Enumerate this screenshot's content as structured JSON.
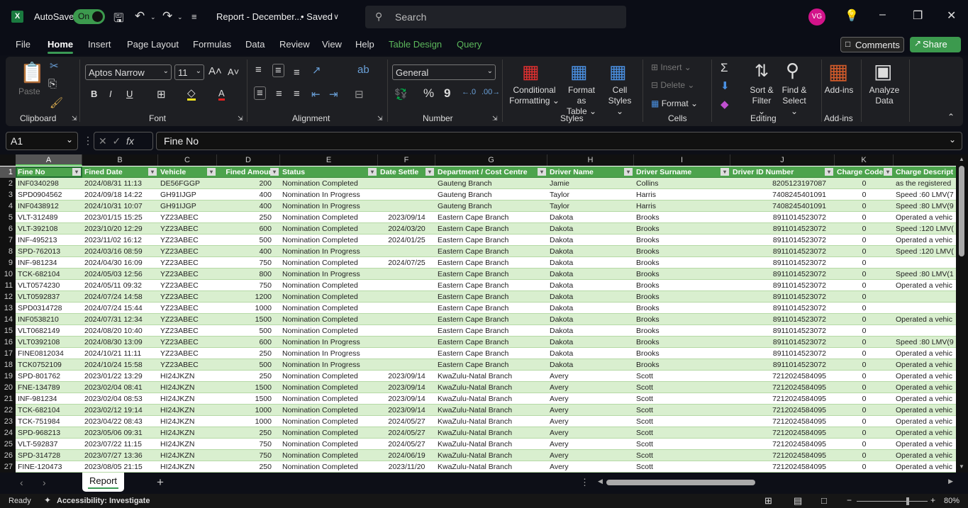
{
  "titlebar": {
    "app_icon": "excel-logo-icon",
    "autosave_label": "AutoSave",
    "autosave_state": "On",
    "doc_title": "Report - December...",
    "doc_status": "• Saved",
    "search_placeholder": "Search",
    "avatar_initials": "VG"
  },
  "menu": {
    "items": [
      "File",
      "Home",
      "Insert",
      "Page Layout",
      "Formulas",
      "Data",
      "Review",
      "View",
      "Help",
      "Table Design",
      "Query"
    ],
    "active": "Home",
    "comments_label": "Comments",
    "share_label": "Share"
  },
  "ribbon": {
    "clipboard": {
      "label": "Clipboard",
      "paste": "Paste"
    },
    "font": {
      "label": "Font",
      "family": "Aptos Narrow",
      "size": "11",
      "bold": "B",
      "italic": "I",
      "underline": "U"
    },
    "alignment": {
      "label": "Alignment"
    },
    "number": {
      "label": "Number",
      "format": "General",
      "percent": "%",
      "comma": "9"
    },
    "styles": {
      "label": "Styles",
      "conditional": "Conditional",
      "conditional2": "Formatting",
      "format_table": "Format as",
      "format_table2": "Table",
      "cell_styles": "Cell",
      "cell_styles2": "Styles"
    },
    "cells": {
      "label": "Cells",
      "insert": "Insert",
      "delete": "Delete",
      "format": "Format"
    },
    "editing": {
      "label": "Editing",
      "sort": "Sort &",
      "sort2": "Filter",
      "find": "Find &",
      "find2": "Select"
    },
    "addins": {
      "label": "Add-ins",
      "addins_btn": "Add-ins"
    },
    "analyze": {
      "label": "Analyze",
      "label2": "Data"
    }
  },
  "formula_bar": {
    "name_box": "A1",
    "fx": "fx",
    "content": "Fine No"
  },
  "columns": [
    "A",
    "B",
    "C",
    "D",
    "E",
    "F",
    "G",
    "H",
    "I",
    "J",
    "K",
    ""
  ],
  "headers": [
    "Fine No",
    "Fined Date",
    "Vehicle",
    "Fined Amour",
    "Status",
    "Date Settle",
    "Department / Cost Centre",
    "Driver Name",
    "Driver Surname",
    "Driver ID Number",
    "Charge Code",
    "Charge Descript"
  ],
  "rows": [
    [
      "INF0340298",
      "2024/08/31 11:13",
      "DE56FGGP",
      "200",
      "Nomination Completed",
      "",
      "Gauteng Branch",
      "Jamie",
      "Collins",
      "8205123197087",
      "0",
      "as the registered"
    ],
    [
      "SPD0904562",
      "2024/09/18 14:22",
      "GH91IJGP",
      "400",
      "Nomination In Progress",
      "",
      "Gauteng Branch",
      "Taylor",
      "Harris",
      "7408245401091",
      "0",
      "Speed :60 LMV(7"
    ],
    [
      "INF0438912",
      "2024/10/31 10:07",
      "GH91IJGP",
      "400",
      "Nomination In Progress",
      "",
      "Gauteng Branch",
      "Taylor",
      "Harris",
      "7408245401091",
      "0",
      "Speed :80 LMV(9"
    ],
    [
      "VLT-312489",
      "2023/01/15 15:25",
      "YZ23ABEC",
      "250",
      "Nomination Completed",
      "2023/09/14",
      "Eastern Cape Branch",
      "Dakota",
      "Brooks",
      "8911014523072",
      "0",
      "Operated a vehic"
    ],
    [
      "VLT-392108",
      "2023/10/20 12:29",
      "YZ23ABEC",
      "600",
      "Nomination Completed",
      "2024/03/20",
      "Eastern Cape Branch",
      "Dakota",
      "Brooks",
      "8911014523072",
      "0",
      "Speed :120 LMV("
    ],
    [
      "INF-495213",
      "2023/11/02 16:12",
      "YZ23ABEC",
      "500",
      "Nomination Completed",
      "2024/01/25",
      "Eastern Cape Branch",
      "Dakota",
      "Brooks",
      "8911014523072",
      "0",
      "Operated a vehic"
    ],
    [
      "SPD-762013",
      "2024/03/16 08:59",
      "YZ23ABEC",
      "400",
      "Nomination In Progress",
      "",
      "Eastern Cape Branch",
      "Dakota",
      "Brooks",
      "8911014523072",
      "0",
      "Speed :120 LMV("
    ],
    [
      "INF-981234",
      "2024/04/30 16:09",
      "YZ23ABEC",
      "750",
      "Nomination Completed",
      "2024/07/25",
      "Eastern Cape Branch",
      "Dakota",
      "Brooks",
      "8911014523072",
      "0",
      ""
    ],
    [
      "TCK-682104",
      "2024/05/03 12:56",
      "YZ23ABEC",
      "800",
      "Nomination In Progress",
      "",
      "Eastern Cape Branch",
      "Dakota",
      "Brooks",
      "8911014523072",
      "0",
      "Speed :80 LMV(1"
    ],
    [
      "VLT0574230",
      "2024/05/11 09:32",
      "YZ23ABEC",
      "750",
      "Nomination Completed",
      "",
      "Eastern Cape Branch",
      "Dakota",
      "Brooks",
      "8911014523072",
      "0",
      "Operated a vehic"
    ],
    [
      "VLT0592837",
      "2024/07/24 14:58",
      "YZ23ABEC",
      "1200",
      "Nomination Completed",
      "",
      "Eastern Cape Branch",
      "Dakota",
      "Brooks",
      "8911014523072",
      "0",
      ""
    ],
    [
      "SPD0314728",
      "2024/07/24 15:44",
      "YZ23ABEC",
      "1000",
      "Nomination Completed",
      "",
      "Eastern Cape Branch",
      "Dakota",
      "Brooks",
      "8911014523072",
      "0",
      ""
    ],
    [
      "INF0538210",
      "2024/07/31 12:34",
      "YZ23ABEC",
      "1500",
      "Nomination Completed",
      "",
      "Eastern Cape Branch",
      "Dakota",
      "Brooks",
      "8911014523072",
      "0",
      "Operated a vehic"
    ],
    [
      "VLT0682149",
      "2024/08/20 10:40",
      "YZ23ABEC",
      "500",
      "Nomination Completed",
      "",
      "Eastern Cape Branch",
      "Dakota",
      "Brooks",
      "8911014523072",
      "0",
      ""
    ],
    [
      "VLT0392108",
      "2024/08/30 13:09",
      "YZ23ABEC",
      "600",
      "Nomination In Progress",
      "",
      "Eastern Cape Branch",
      "Dakota",
      "Brooks",
      "8911014523072",
      "0",
      "Speed :80 LMV(9"
    ],
    [
      "FINE0812034",
      "2024/10/21 11:11",
      "YZ23ABEC",
      "250",
      "Nomination In Progress",
      "",
      "Eastern Cape Branch",
      "Dakota",
      "Brooks",
      "8911014523072",
      "0",
      "Operated a vehic"
    ],
    [
      "TCK0752109",
      "2024/10/24 15:58",
      "YZ23ABEC",
      "500",
      "Nomination In Progress",
      "",
      "Eastern Cape Branch",
      "Dakota",
      "Brooks",
      "8911014523072",
      "0",
      "Operated a vehic"
    ],
    [
      "SPD-801762",
      "2023/01/22 13:29",
      "HI24JKZN",
      "250",
      "Nomination Completed",
      "2023/09/14",
      "KwaZulu-Natal Branch",
      "Avery",
      "Scott",
      "7212024584095",
      "0",
      "Operated a vehic"
    ],
    [
      "FNE-134789",
      "2023/02/04 08:41",
      "HI24JKZN",
      "1500",
      "Nomination Completed",
      "2023/09/14",
      "KwaZulu-Natal Branch",
      "Avery",
      "Scott",
      "7212024584095",
      "0",
      "Operated a vehic"
    ],
    [
      "INF-981234",
      "2023/02/04 08:53",
      "HI24JKZN",
      "1500",
      "Nomination Completed",
      "2023/09/14",
      "KwaZulu-Natal Branch",
      "Avery",
      "Scott",
      "7212024584095",
      "0",
      "Operated a vehic"
    ],
    [
      "TCK-682104",
      "2023/02/12 19:14",
      "HI24JKZN",
      "1000",
      "Nomination Completed",
      "2023/09/14",
      "KwaZulu-Natal Branch",
      "Avery",
      "Scott",
      "7212024584095",
      "0",
      "Operated a vehic"
    ],
    [
      "TCK-751984",
      "2023/04/22 08:43",
      "HI24JKZN",
      "1000",
      "Nomination Completed",
      "2024/05/27",
      "KwaZulu-Natal Branch",
      "Avery",
      "Scott",
      "7212024584095",
      "0",
      "Operated a vehic"
    ],
    [
      "SPD-968213",
      "2023/05/06 09:31",
      "HI24JKZN",
      "250",
      "Nomination Completed",
      "2024/05/27",
      "KwaZulu-Natal Branch",
      "Avery",
      "Scott",
      "7212024584095",
      "0",
      "Operated a vehic"
    ],
    [
      "VLT-592837",
      "2023/07/22 11:15",
      "HI24JKZN",
      "750",
      "Nomination Completed",
      "2024/05/27",
      "KwaZulu-Natal Branch",
      "Avery",
      "Scott",
      "7212024584095",
      "0",
      "Operated a vehic"
    ],
    [
      "SPD-314728",
      "2023/07/27 13:36",
      "HI24JKZN",
      "750",
      "Nomination Completed",
      "2024/06/19",
      "KwaZulu-Natal Branch",
      "Avery",
      "Scott",
      "7212024584095",
      "0",
      "Operated a vehic"
    ],
    [
      "FINE-120473",
      "2023/08/05 21:15",
      "HI24JKZN",
      "250",
      "Nomination Completed",
      "2023/11/20",
      "KwaZulu-Natal Branch",
      "Avery",
      "Scott",
      "7212024584095",
      "0",
      "Operated a vehic"
    ]
  ],
  "sheets": {
    "active": "Report",
    "add": "+"
  },
  "status": {
    "ready": "Ready",
    "accessibility": "Accessibility: Investigate",
    "zoom": "80%",
    "zoom_fraction": 0.8
  },
  "colors": {
    "accent": "#3c9a4e",
    "table_header": "#4ca34c",
    "band": "#d9efcf",
    "avatar": "#d3138a"
  }
}
